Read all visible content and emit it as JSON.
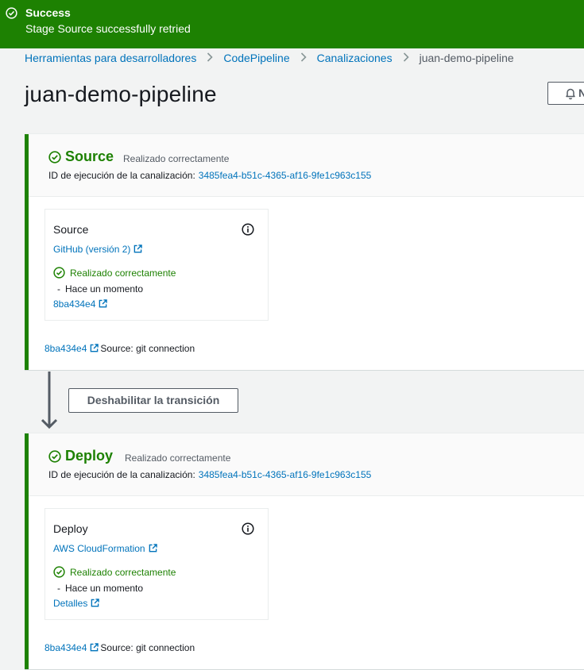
{
  "flash": {
    "title": "Success",
    "message": "Stage Source successfully retried",
    "icon": "check-circle-icon",
    "color": "#1d8102"
  },
  "breadcrumb": {
    "items": [
      "Herramientas para desarrolladores",
      "CodePipeline",
      "Canalizaciones"
    ],
    "current": "juan-demo-pipeline"
  },
  "page": {
    "title": "juan-demo-pipeline",
    "notify_label": "N",
    "notify_icon": "bell-icon"
  },
  "stages": [
    {
      "name": "Source",
      "status": "Realizado correctamente",
      "exec_label": "ID de ejecución de la canalización:",
      "exec_id": "3485fea4-b51c-4365-af16-9fe1c963c155",
      "action": {
        "title": "Source",
        "provider": "GitHub (versión 2)",
        "status": "Realizado correctamente",
        "time_prefix": "-",
        "time": "Hace un momento",
        "link": "8ba434e4"
      },
      "footer": {
        "commit": "8ba434e4",
        "source_text": "Source: git connection"
      }
    },
    {
      "name": "Deploy",
      "status": "Realizado correctamente",
      "exec_label": "ID de ejecución de la canalización:",
      "exec_id": "3485fea4-b51c-4365-af16-9fe1c963c155",
      "action": {
        "title": "Deploy",
        "provider": "AWS CloudFormation",
        "status": "Realizado correctamente",
        "time_prefix": "-",
        "time": "Hace un momento",
        "link": "Detalles"
      },
      "footer": {
        "commit": "8ba434e4",
        "source_text": "Source: git connection"
      }
    }
  ],
  "transition": {
    "button_label": "Deshabilitar la transición",
    "icon": "arrow-down-icon"
  },
  "colors": {
    "success": "#1d8102",
    "link": "#0073bb",
    "background": "#f2f3f3"
  }
}
